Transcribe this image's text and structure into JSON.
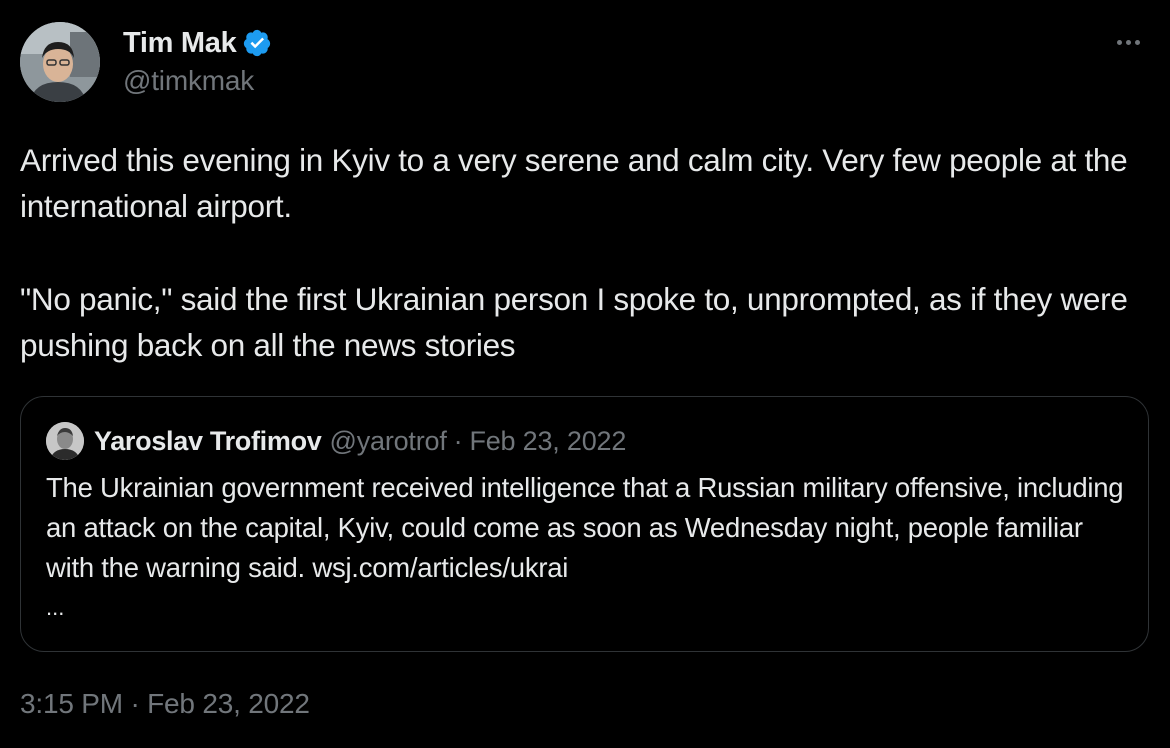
{
  "tweet": {
    "author": {
      "display_name": "Tim Mak",
      "handle": "@timkmak",
      "verified": true,
      "verified_color": "#1d9bf0"
    },
    "more_icon": "more-horizontal-icon",
    "text": [
      "Arrived this evening in Kyiv to a very serene and calm city. Very few people at the international airport.",
      "\"No panic,\" said the first Ukrainian person I spoke to, unprompted, as if they were pushing back on all the news stories"
    ],
    "quote": {
      "display_name": "Yaroslav Trofimov",
      "handle": "@yarotrof",
      "separator": "·",
      "date": "Feb 23, 2022",
      "text": "The Ukrainian government received intelligence that a Russian military offensive, including an attack on the capital, Kyiv, could come as soon as Wednesday night, people familiar with the warning said. wsj.com/articles/ukrai",
      "ellipsis": "..."
    },
    "timestamp": "3:15 PM · Feb 23, 2022"
  },
  "colors": {
    "background": "#000000",
    "text_primary": "#e7e9ea",
    "text_secondary": "#71767b",
    "border": "#2f3336"
  }
}
